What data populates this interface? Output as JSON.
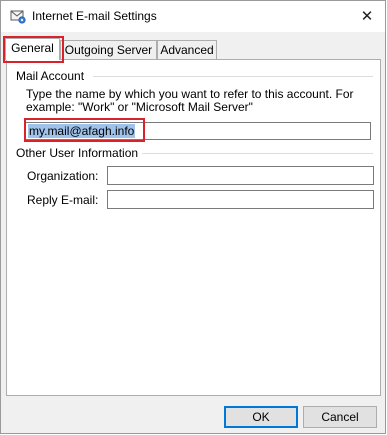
{
  "window": {
    "title": "Internet E-mail Settings",
    "close_glyph": "✕"
  },
  "tabs": [
    {
      "label": "General",
      "active": true
    },
    {
      "label": "Outgoing Server",
      "active": false
    },
    {
      "label": "Advanced",
      "active": false
    }
  ],
  "mail_account": {
    "group_label": "Mail Account",
    "description": "Type the name by which you want to refer to this account. For example: \"Work\" or \"Microsoft Mail Server\"",
    "value": "my.mail@afagh.info"
  },
  "other_info": {
    "group_label": "Other User Information",
    "organization_label": "Organization:",
    "organization_value": "",
    "reply_label": "Reply E-mail:",
    "reply_value": ""
  },
  "buttons": {
    "ok": "OK",
    "cancel": "Cancel"
  },
  "colors": {
    "highlight": "#d9232c",
    "selection": "#9ec2ea",
    "accent": "#0078d7"
  }
}
